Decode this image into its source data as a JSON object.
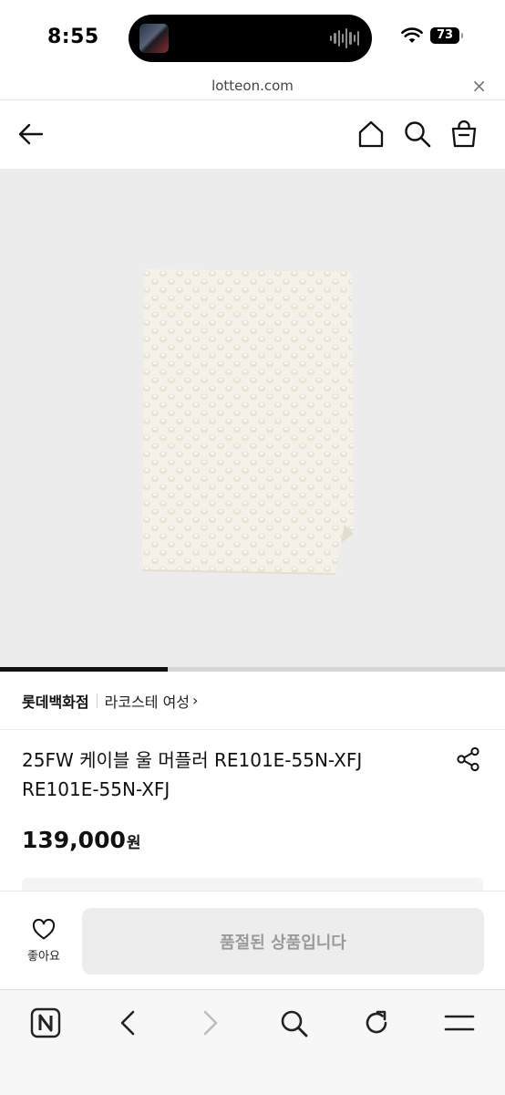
{
  "status_bar": {
    "time": "8:55",
    "battery": "73"
  },
  "url_bar": {
    "domain": "lotteon.com",
    "close_symbol": "×"
  },
  "header": {
    "icons": [
      "back-arrow-icon",
      "home-icon",
      "search-icon",
      "shopping-bag-icon"
    ]
  },
  "gallery": {
    "progress": 0.333
  },
  "brand": {
    "store": "롯데백화점",
    "name": "라코스테 여성",
    "chevron": "›"
  },
  "product": {
    "title": "25FW 케이블 울 머플러 RE101E-55N-XFJ RE101E-55N-XFJ",
    "price": "139,000",
    "currency": "원"
  },
  "purchase_bar": {
    "like_label": "좋아요",
    "soldout_label": "품절된 상품입니다"
  },
  "browser_toolbar": {
    "icons": [
      "naver-logo-icon",
      "back-icon",
      "forward-icon",
      "search-icon",
      "reload-icon",
      "menu-icon"
    ]
  }
}
